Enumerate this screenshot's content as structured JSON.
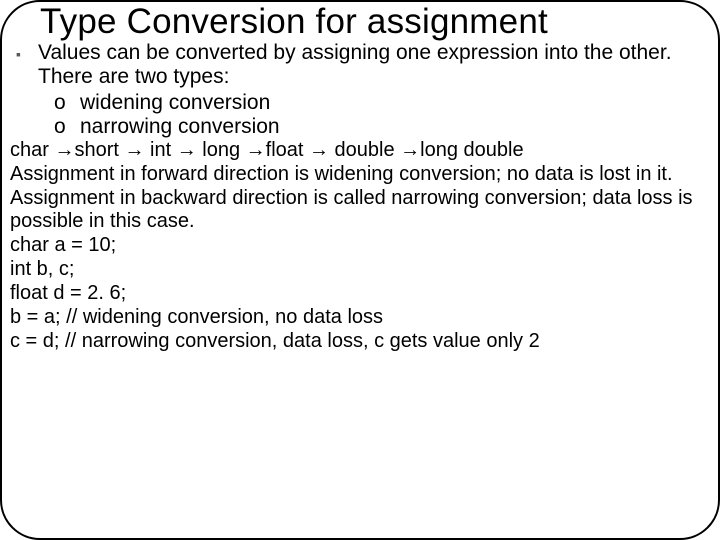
{
  "title": "Type Conversion for assignment",
  "bullet": {
    "marker": "▪",
    "text": "Values can be converted by assigning one expression into the other. There are two types:",
    "sub": [
      {
        "marker": "o",
        "text": "widening conversion"
      },
      {
        "marker": "o",
        "text": "narrowing conversion"
      }
    ]
  },
  "lines": [
    "char →short → int → long →float → double →long double",
    "Assignment in forward direction is widening conversion; no data is lost in it.",
    "Assignment in backward direction is called narrowing conversion; data loss is possible in this case.",
    "char a = 10;",
    "int b, c;",
    "float d = 2. 6;",
    "b = a;    // widening conversion, no data loss",
    "c = d;    // narrowing conversion, data loss, c gets value only 2"
  ]
}
